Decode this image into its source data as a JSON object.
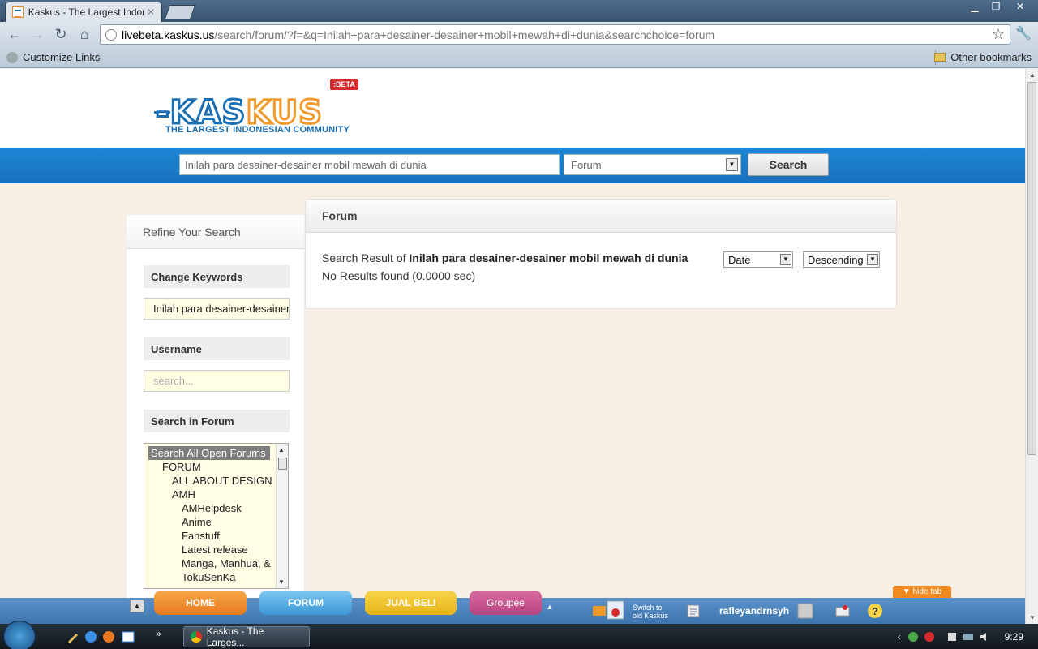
{
  "browser": {
    "tab_title": "Kaskus - The Largest Indon",
    "url_host": "livebeta.kaskus.us",
    "url_rest": "/search/forum/?f=&q=Inilah+para+desainer-desainer+mobil+mewah+di+dunia&searchchoice=forum",
    "bookmarks": {
      "left": "Customize Links",
      "right": "Other bookmarks"
    }
  },
  "header": {
    "logo_word_a": "-KAS",
    "logo_word_b": "KUS",
    "logo_tagline": "THE LARGEST INDONESIAN COMMUNITY",
    "logo_badge": ":BETA"
  },
  "search": {
    "query_value": "Inilah para desainer-desainer mobil mewah di dunia",
    "scope_value": "Forum",
    "button_label": "Search"
  },
  "sidebar": {
    "title": "Refine Your Search",
    "change_keywords_label": "Change Keywords",
    "keywords_value": "Inilah para desainer-desainer",
    "username_label": "Username",
    "username_placeholder": "search...",
    "search_in_forum_label": "Search in Forum",
    "forums": [
      {
        "label": "Search All Open Forums",
        "indent": 0,
        "selected": true
      },
      {
        "label": "FORUM",
        "indent": 1
      },
      {
        "label": "ALL ABOUT DESIGN",
        "indent": 2
      },
      {
        "label": "AMH",
        "indent": 2
      },
      {
        "label": "AMHelpdesk",
        "indent": 3
      },
      {
        "label": "Anime",
        "indent": 3
      },
      {
        "label": "Fanstuff",
        "indent": 3
      },
      {
        "label": "Latest release",
        "indent": 3
      },
      {
        "label": "Manga, Manhua, &",
        "indent": 3
      },
      {
        "label": "TokuSenKa",
        "indent": 3
      }
    ]
  },
  "main": {
    "panel_title": "Forum",
    "result_prefix": "Search Result of ",
    "result_query": "Inilah para desainer-desainer mobil mewah di dunia",
    "no_results": "No Results found (0.0000 sec)",
    "sort_by": "Date",
    "sort_order": "Descending"
  },
  "kaskus_bar": {
    "hide_tab": "hide tab",
    "tabs": [
      "HOME",
      "FORUM",
      "JUAL BELI",
      "Groupee"
    ],
    "switch_line1": "Switch to",
    "switch_line2": "old Kaskus",
    "username": "rafleyandrnsyh"
  },
  "taskbar": {
    "task_label": "Kaskus - The Larges...",
    "clock": "9:29"
  }
}
